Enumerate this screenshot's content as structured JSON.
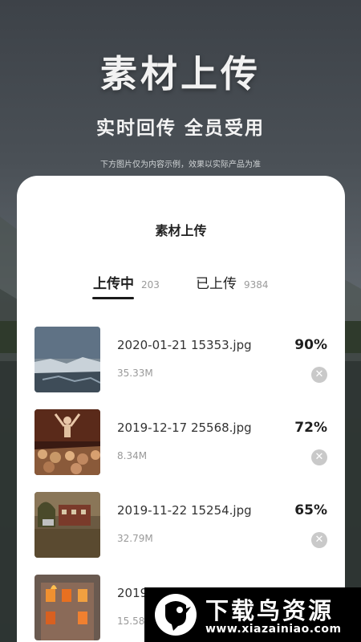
{
  "hero": {
    "title": "素材上传",
    "subtitle": "实时回传 全员受用",
    "note": "下方图片仅为内容示例，效果以实际产品为准"
  },
  "screen": {
    "title": "素材上传",
    "tabs": [
      {
        "label": "上传中",
        "count": "203",
        "active": true
      },
      {
        "label": "已上传",
        "count": "9384",
        "active": false
      }
    ]
  },
  "files": [
    {
      "name": "2020-01-21 15353.jpg",
      "size": "35.33M",
      "progress": "90%",
      "thumb_icon": "landscape-icon"
    },
    {
      "name": "2019-12-17 25568.jpg",
      "size": "8.34M",
      "progress": "72%",
      "thumb_icon": "concert-icon"
    },
    {
      "name": "2019-11-22 15254.jpg",
      "size": "32.79M",
      "progress": "65%",
      "thumb_icon": "house-icon"
    },
    {
      "name": "2019",
      "size": "15.58",
      "progress": "",
      "thumb_icon": "fire-house-icon"
    }
  ],
  "remove_glyph": "✕",
  "watermark": {
    "name": "下载鸟资源",
    "url": "www.xiazainiao.com"
  },
  "colors": {
    "card_bg": "#ffffff",
    "text_primary": "#222222",
    "text_muted": "#999999",
    "remove_button": "#c9c9c9"
  }
}
